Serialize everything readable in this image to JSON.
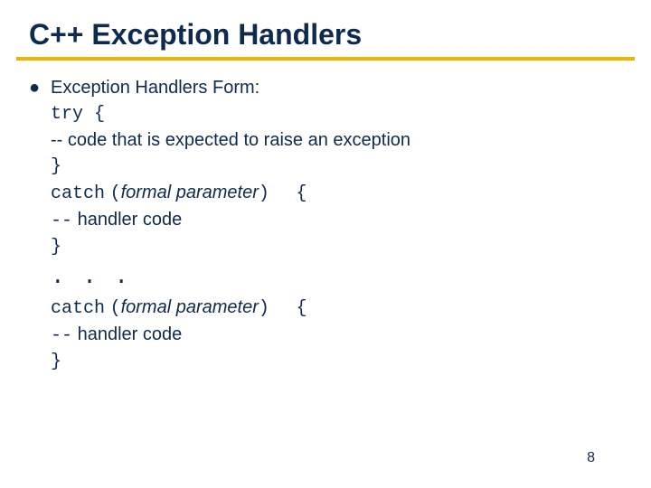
{
  "title": "C++ Exception Handlers",
  "lead": "Exception Handlers Form:",
  "try_open": "try {",
  "try_comment": "-- code that is expected to raise an exception",
  "close_brace": "}",
  "catch_kw": "catch",
  "paren_open": "(",
  "formal_param": "formal parameter",
  "paren_close": ")",
  "open_block": "{",
  "handler_dashes": "--",
  "handler_text": " handler code",
  "ellipsis": ". . .",
  "page_number": "8"
}
